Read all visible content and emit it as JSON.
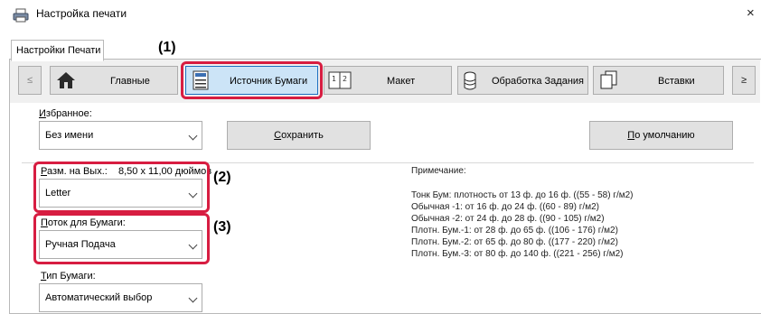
{
  "window": {
    "title": "Настройка печати",
    "close_label": "×"
  },
  "tab": {
    "label": "Настройки Печати"
  },
  "nav": {
    "prev": "≤",
    "next": "≥"
  },
  "toolbar": {
    "main": "Главные",
    "paper_source": "Источник Бумаги",
    "layout": "Макет",
    "job_handling": "Обработка Задания",
    "inserts": "Вставки"
  },
  "favorites": {
    "label_ul": "И",
    "label_rest": "збранное:",
    "value": "Без имени",
    "save_ul": "С",
    "save_rest": "охранить",
    "default_ul": "П",
    "default_rest": "о умолчанию"
  },
  "output_size": {
    "label_ul": "Р",
    "label_rest": "азм. на Вых.:",
    "dims": "8,50 x 11,00 дюймов",
    "value": "Letter"
  },
  "paper_tray": {
    "label_ul": "П",
    "label_rest": "оток для Бумаги:",
    "value": "Ручная Подача"
  },
  "paper_type": {
    "label_ul": "Т",
    "label_rest": "ип Бумаги:",
    "value": "Автоматический выбор"
  },
  "notes": {
    "title": "Примечание:",
    "lines": [
      "Тонк Бум: плотность от 13 ф. до 16 ф. ((55 - 58) г/м2)",
      "Обычная -1: от 16 ф. до 24 ф. ((60 - 89) г/м2)",
      "Обычная -2: от 24 ф. до 28 ф. ((90 - 105) г/м2)",
      "Плотн. Бум.-1: от 28 ф. до 65 ф. ((106 - 176) г/м2)",
      "Плотн. Бум.-2: от 65 ф. до 80 ф. ((177 - 220) г/м2)",
      "Плотн. Бум.-3: от 80 ф. до 140 ф. ((221 - 256) г/м2)"
    ]
  },
  "callouts": {
    "c1": "(1)",
    "c2": "(2)",
    "c3": "(3)"
  },
  "colors": {
    "highlight": "#d71d41",
    "selected": "#cce4f7",
    "selected_border": "#1c6fbf"
  }
}
